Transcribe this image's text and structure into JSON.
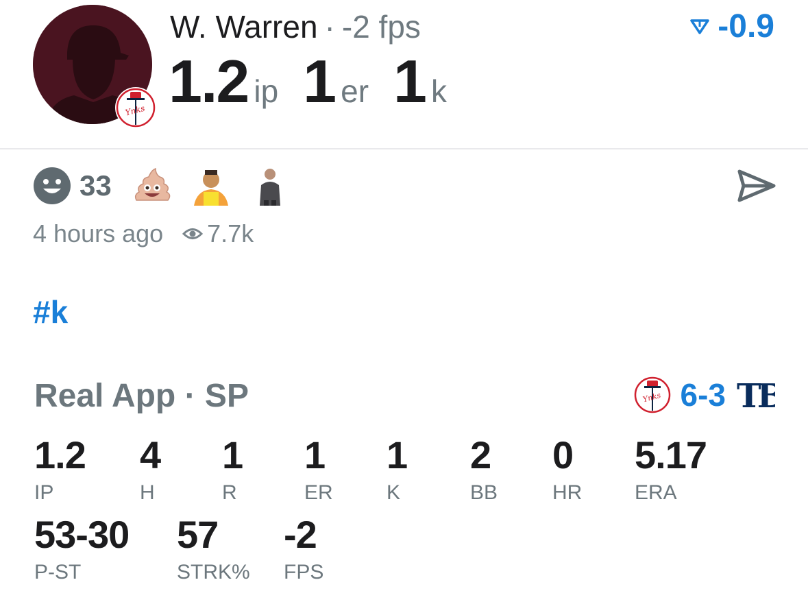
{
  "post": {
    "player_name": "W. Warren",
    "separator": "·",
    "fps_summary": "-2 fps",
    "value_delta": "-0.9",
    "stat_line": [
      {
        "value": "1.2",
        "unit": "ip"
      },
      {
        "value": "1",
        "unit": "er"
      },
      {
        "value": "1",
        "unit": "k"
      }
    ],
    "reaction_count": "33",
    "time_ago": "4 hours ago",
    "views": "7.7k",
    "hashtag": "#k"
  },
  "icons": {
    "avatar": "player-silhouette",
    "team": "yankees-logo",
    "delta": "down-triangle-icon",
    "reaction": "smile-icon",
    "reactions_shown": [
      "poop-emoji",
      "person-reaction-icon",
      "person-reaction-icon"
    ],
    "share": "send-icon",
    "views": "eye-icon",
    "opponent": "rays-logo"
  },
  "card": {
    "source": "Real App",
    "separator": "·",
    "position": "SP",
    "score": "6-3",
    "stats": [
      {
        "label": "IP",
        "value": "1.2"
      },
      {
        "label": "H",
        "value": "4"
      },
      {
        "label": "R",
        "value": "1"
      },
      {
        "label": "ER",
        "value": "1"
      },
      {
        "label": "K",
        "value": "1"
      },
      {
        "label": "BB",
        "value": "2"
      },
      {
        "label": "HR",
        "value": "0"
      },
      {
        "label": "ERA",
        "value": "5.17"
      },
      {
        "label": "P-ST",
        "value": "53-30"
      },
      {
        "label": "STRK%",
        "value": "57"
      },
      {
        "label": "FPS",
        "value": "-2"
      }
    ]
  },
  "colors": {
    "accent": "#1a7fd8",
    "text_dark": "#1c1c1e",
    "text_muted": "#6c777d",
    "avatar_bg": "#4a1420",
    "yankees_red": "#d0202e",
    "yankees_navy": "#0c2340",
    "rays_navy": "#092c5c"
  }
}
